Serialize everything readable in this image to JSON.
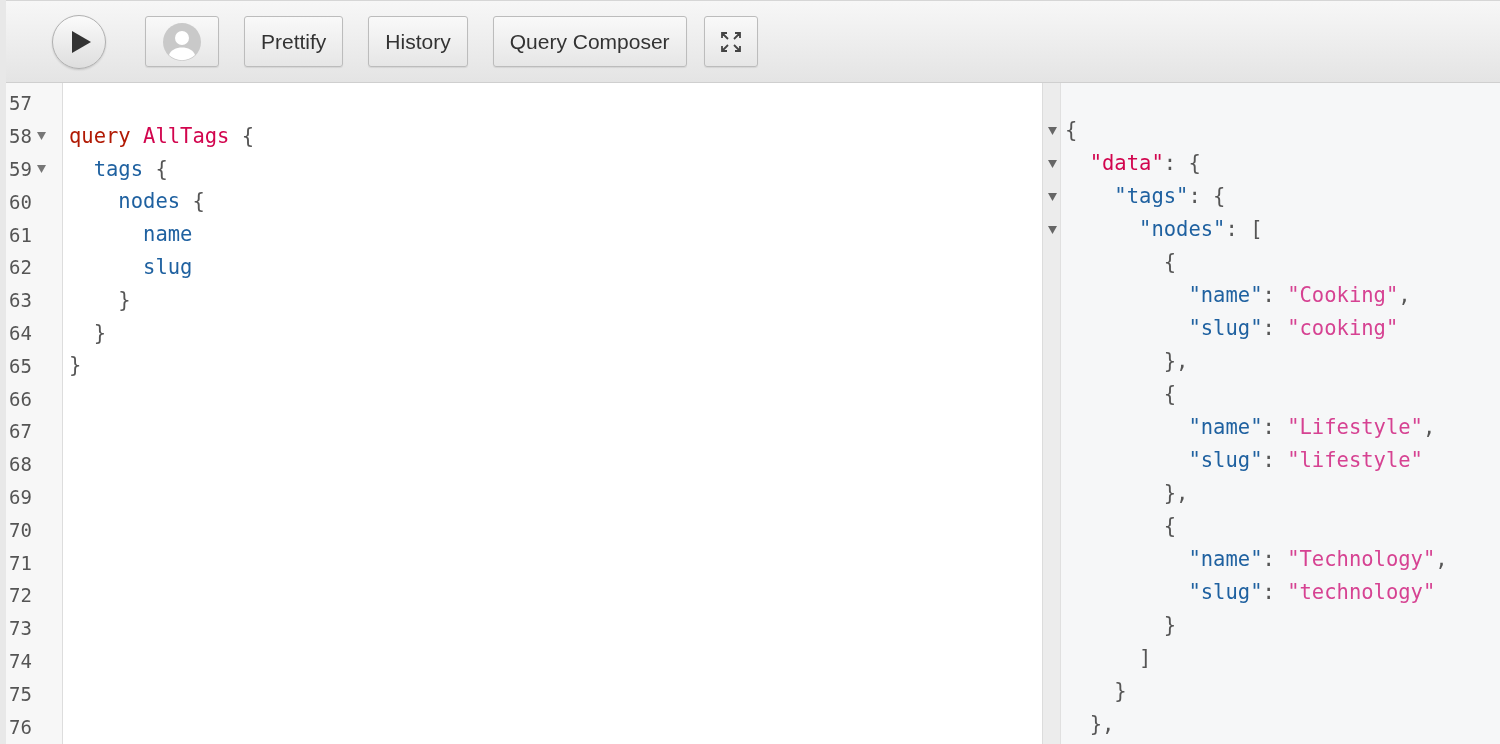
{
  "toolbar": {
    "buttons": [
      {
        "kind": "run"
      },
      {
        "kind": "avatar"
      },
      {
        "kind": "text",
        "label": "Prettify"
      },
      {
        "kind": "text",
        "label": "History"
      },
      {
        "kind": "text",
        "label": "Query Composer"
      },
      {
        "kind": "fullscreen"
      }
    ]
  },
  "editor": {
    "lines": [
      {
        "number": "57",
        "foldable": false
      },
      {
        "number": "58",
        "foldable": true,
        "tokens": [
          {
            "kind": "keyword",
            "text": "query"
          },
          {
            "kind": "def",
            "text": " AllTags"
          },
          {
            "kind": "punct",
            "text": " {"
          }
        ]
      },
      {
        "number": "59",
        "foldable": true,
        "tokens": [
          {
            "kind": "field",
            "text": "  tags"
          },
          {
            "kind": "punct",
            "text": " {"
          }
        ]
      },
      {
        "number": "60",
        "foldable": false,
        "tokens": [
          {
            "kind": "field",
            "text": "    nodes"
          },
          {
            "kind": "punct",
            "text": " {"
          }
        ]
      },
      {
        "number": "61",
        "foldable": false,
        "tokens": [
          {
            "kind": "field",
            "text": "      name"
          }
        ]
      },
      {
        "number": "62",
        "foldable": false,
        "tokens": [
          {
            "kind": "field",
            "text": "      slug"
          }
        ]
      },
      {
        "number": "63",
        "foldable": false,
        "tokens": [
          {
            "kind": "punct",
            "text": "    }"
          }
        ]
      },
      {
        "number": "64",
        "foldable": false,
        "tokens": [
          {
            "kind": "punct",
            "text": "  }"
          }
        ]
      },
      {
        "number": "65",
        "foldable": false,
        "tokens": [
          {
            "kind": "punct",
            "text": "}"
          }
        ]
      },
      {
        "number": "66",
        "foldable": false
      },
      {
        "number": "67",
        "foldable": false
      },
      {
        "number": "68",
        "foldable": false
      },
      {
        "number": "69",
        "foldable": false
      },
      {
        "number": "70",
        "foldable": false
      },
      {
        "number": "71",
        "foldable": false
      },
      {
        "number": "72",
        "foldable": false
      },
      {
        "number": "73",
        "foldable": false
      },
      {
        "number": "74",
        "foldable": false
      },
      {
        "number": "75",
        "foldable": false
      },
      {
        "number": "76",
        "foldable": false
      }
    ]
  },
  "result": {
    "lines": [
      {
        "foldable": true,
        "tokens": [
          {
            "kind": "punct",
            "text": "{"
          }
        ]
      },
      {
        "foldable": true,
        "tokens": [
          {
            "kind": "def",
            "text": "  \"data\""
          },
          {
            "kind": "punct",
            "text": ": {"
          }
        ]
      },
      {
        "foldable": true,
        "tokens": [
          {
            "kind": "field",
            "text": "    \"tags\""
          },
          {
            "kind": "punct",
            "text": ": {"
          }
        ]
      },
      {
        "foldable": true,
        "tokens": [
          {
            "kind": "field",
            "text": "      \"nodes\""
          },
          {
            "kind": "punct",
            "text": ": ["
          }
        ]
      },
      {
        "foldable": false,
        "tokens": [
          {
            "kind": "punct",
            "text": "        {"
          }
        ]
      },
      {
        "foldable": false,
        "tokens": [
          {
            "kind": "field",
            "text": "          \"name\""
          },
          {
            "kind": "punct",
            "text": ": "
          },
          {
            "kind": "string",
            "text": "\"Cooking\""
          },
          {
            "kind": "punct",
            "text": ","
          }
        ]
      },
      {
        "foldable": false,
        "tokens": [
          {
            "kind": "field",
            "text": "          \"slug\""
          },
          {
            "kind": "punct",
            "text": ": "
          },
          {
            "kind": "string",
            "text": "\"cooking\""
          }
        ]
      },
      {
        "foldable": false,
        "tokens": [
          {
            "kind": "punct",
            "text": "        },"
          }
        ]
      },
      {
        "foldable": false,
        "tokens": [
          {
            "kind": "punct",
            "text": "        {"
          }
        ]
      },
      {
        "foldable": false,
        "tokens": [
          {
            "kind": "field",
            "text": "          \"name\""
          },
          {
            "kind": "punct",
            "text": ": "
          },
          {
            "kind": "string",
            "text": "\"Lifestyle\""
          },
          {
            "kind": "punct",
            "text": ","
          }
        ]
      },
      {
        "foldable": false,
        "tokens": [
          {
            "kind": "field",
            "text": "          \"slug\""
          },
          {
            "kind": "punct",
            "text": ": "
          },
          {
            "kind": "string",
            "text": "\"lifestyle\""
          }
        ]
      },
      {
        "foldable": false,
        "tokens": [
          {
            "kind": "punct",
            "text": "        },"
          }
        ]
      },
      {
        "foldable": false,
        "tokens": [
          {
            "kind": "punct",
            "text": "        {"
          }
        ]
      },
      {
        "foldable": false,
        "tokens": [
          {
            "kind": "field",
            "text": "          \"name\""
          },
          {
            "kind": "punct",
            "text": ": "
          },
          {
            "kind": "string",
            "text": "\"Technology\""
          },
          {
            "kind": "punct",
            "text": ","
          }
        ]
      },
      {
        "foldable": false,
        "tokens": [
          {
            "kind": "field",
            "text": "          \"slug\""
          },
          {
            "kind": "punct",
            "text": ": "
          },
          {
            "kind": "string",
            "text": "\"technology\""
          }
        ]
      },
      {
        "foldable": false,
        "tokens": [
          {
            "kind": "punct",
            "text": "        }"
          }
        ]
      },
      {
        "foldable": false,
        "tokens": [
          {
            "kind": "punct",
            "text": "      ]"
          }
        ]
      },
      {
        "foldable": false,
        "tokens": [
          {
            "kind": "punct",
            "text": "    }"
          }
        ]
      },
      {
        "foldable": false,
        "tokens": [
          {
            "kind": "punct",
            "text": "  },"
          }
        ]
      }
    ]
  }
}
